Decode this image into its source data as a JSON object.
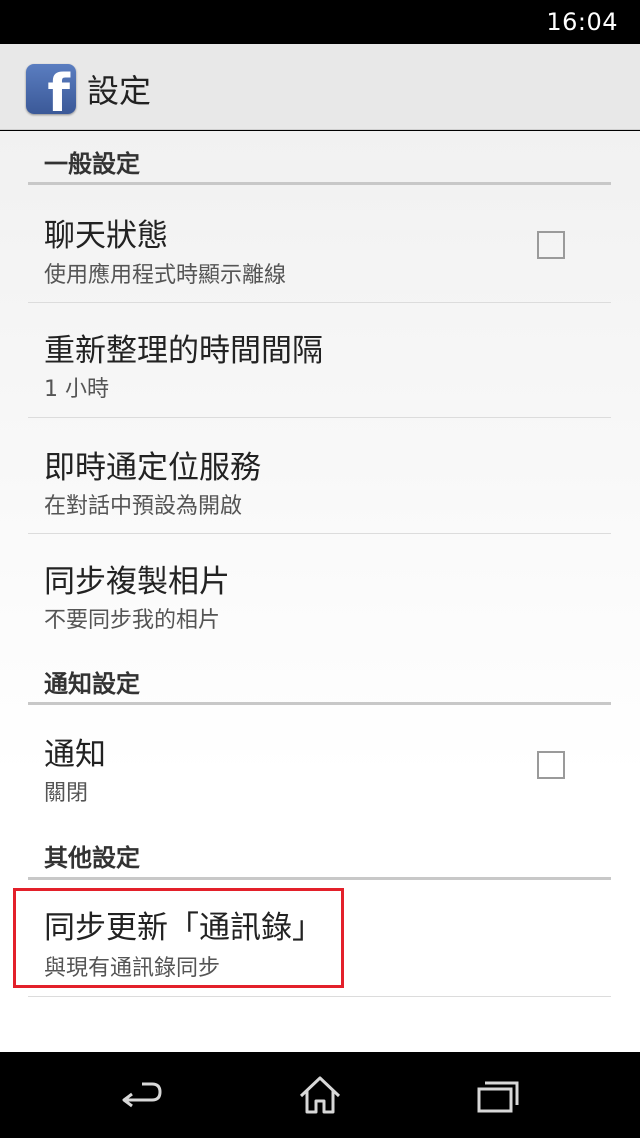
{
  "status_bar": {
    "time": "16:04"
  },
  "action_bar": {
    "title": "設定",
    "app_icon_glyph": "f",
    "app_icon": "facebook-icon"
  },
  "sections": {
    "general": {
      "header": "一般設定",
      "items": [
        {
          "title": "聊天狀態",
          "summary": "使用應用程式時顯示離線",
          "checked": false
        },
        {
          "title": "重新整理的時間間隔",
          "summary": "1 小時"
        },
        {
          "title": "即時通定位服務",
          "summary": "在對話中預設為開啟"
        },
        {
          "title": "同步複製相片",
          "summary": "不要同步我的相片"
        }
      ]
    },
    "notifications": {
      "header": "通知設定",
      "items": [
        {
          "title": "通知",
          "summary": "關閉",
          "checked": false
        }
      ]
    },
    "other": {
      "header": "其他設定",
      "items": [
        {
          "title": "同步更新「通訊錄」",
          "summary": "與現有通訊錄同步"
        }
      ]
    }
  },
  "highlight_color": "#e3202a",
  "nav_bar": {
    "back": "back-icon",
    "home": "home-icon",
    "recents": "recents-icon"
  }
}
